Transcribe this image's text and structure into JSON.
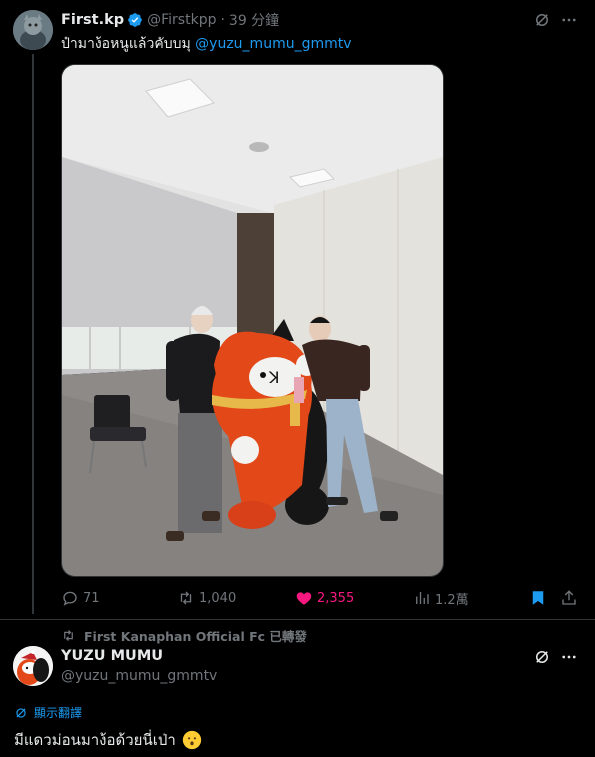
{
  "tweet": {
    "display_name": "First.kp",
    "handle": "@Firstkpp",
    "dot": "·",
    "time": "39 分鐘",
    "text": "ป๋ามาง้อหนูแล้วคับบมุ",
    "mention": "@yuzu_mumu_gmmtv",
    "actions": {
      "replies": "71",
      "retweets": "1,040",
      "likes": "2,355",
      "views": "1.2萬"
    }
  },
  "retweet_context": "First Kanaphan Official Fc 已轉發",
  "tweet2": {
    "display_name": "YUZU MUMU",
    "handle": "@yuzu_mumu_gmmtv",
    "translate": "顯示翻譯",
    "text": "มีแดวม่อนมาง้อด้วยนี่เป่า"
  },
  "colors": {
    "accent": "#1d9bf0",
    "like": "#f91880",
    "muted": "#71767b",
    "text": "#e7e9ea",
    "background": "#000000"
  },
  "icons": [
    "verified-badge-icon",
    "grok-icon",
    "more-icon",
    "reply-icon",
    "retweet-icon",
    "heart-icon",
    "views-icon",
    "bookmark-icon",
    "share-icon",
    "translate-icon",
    "hushed-face-emoji"
  ]
}
